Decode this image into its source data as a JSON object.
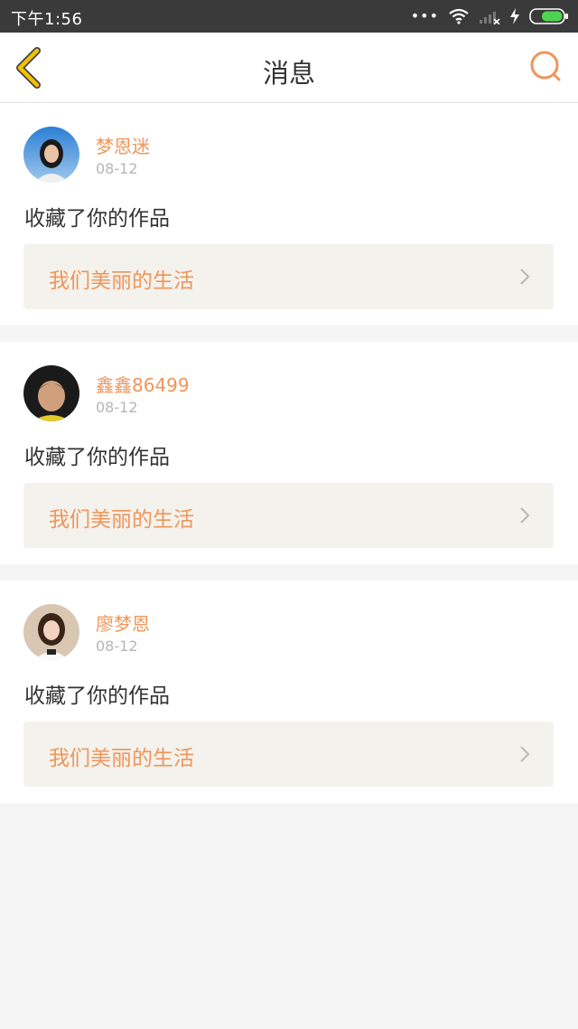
{
  "status_bar": {
    "time": "下午1:56",
    "dots": "•••",
    "icons": [
      "wifi-icon",
      "signal-icon",
      "charging-icon",
      "battery-icon"
    ]
  },
  "header": {
    "title": "消息",
    "back_icon": "back-chevron-icon",
    "search_icon": "search-icon"
  },
  "colors": {
    "accent": "#f0955a",
    "back_arrow": "#f2c100",
    "card_bg": "#ffffff",
    "work_bg": "#f3f2ed",
    "page_bg": "#f5f5f5"
  },
  "notifications": [
    {
      "user": "梦恩迷",
      "date": "08-12",
      "action": "收藏了你的作品",
      "work_title": "我们美丽的生活"
    },
    {
      "user": "鑫鑫86499",
      "date": "08-12",
      "action": "收藏了你的作品",
      "work_title": "我们美丽的生活"
    },
    {
      "user": "廖梦恩",
      "date": "08-12",
      "action": "收藏了你的作品",
      "work_title": "我们美丽的生活"
    }
  ]
}
